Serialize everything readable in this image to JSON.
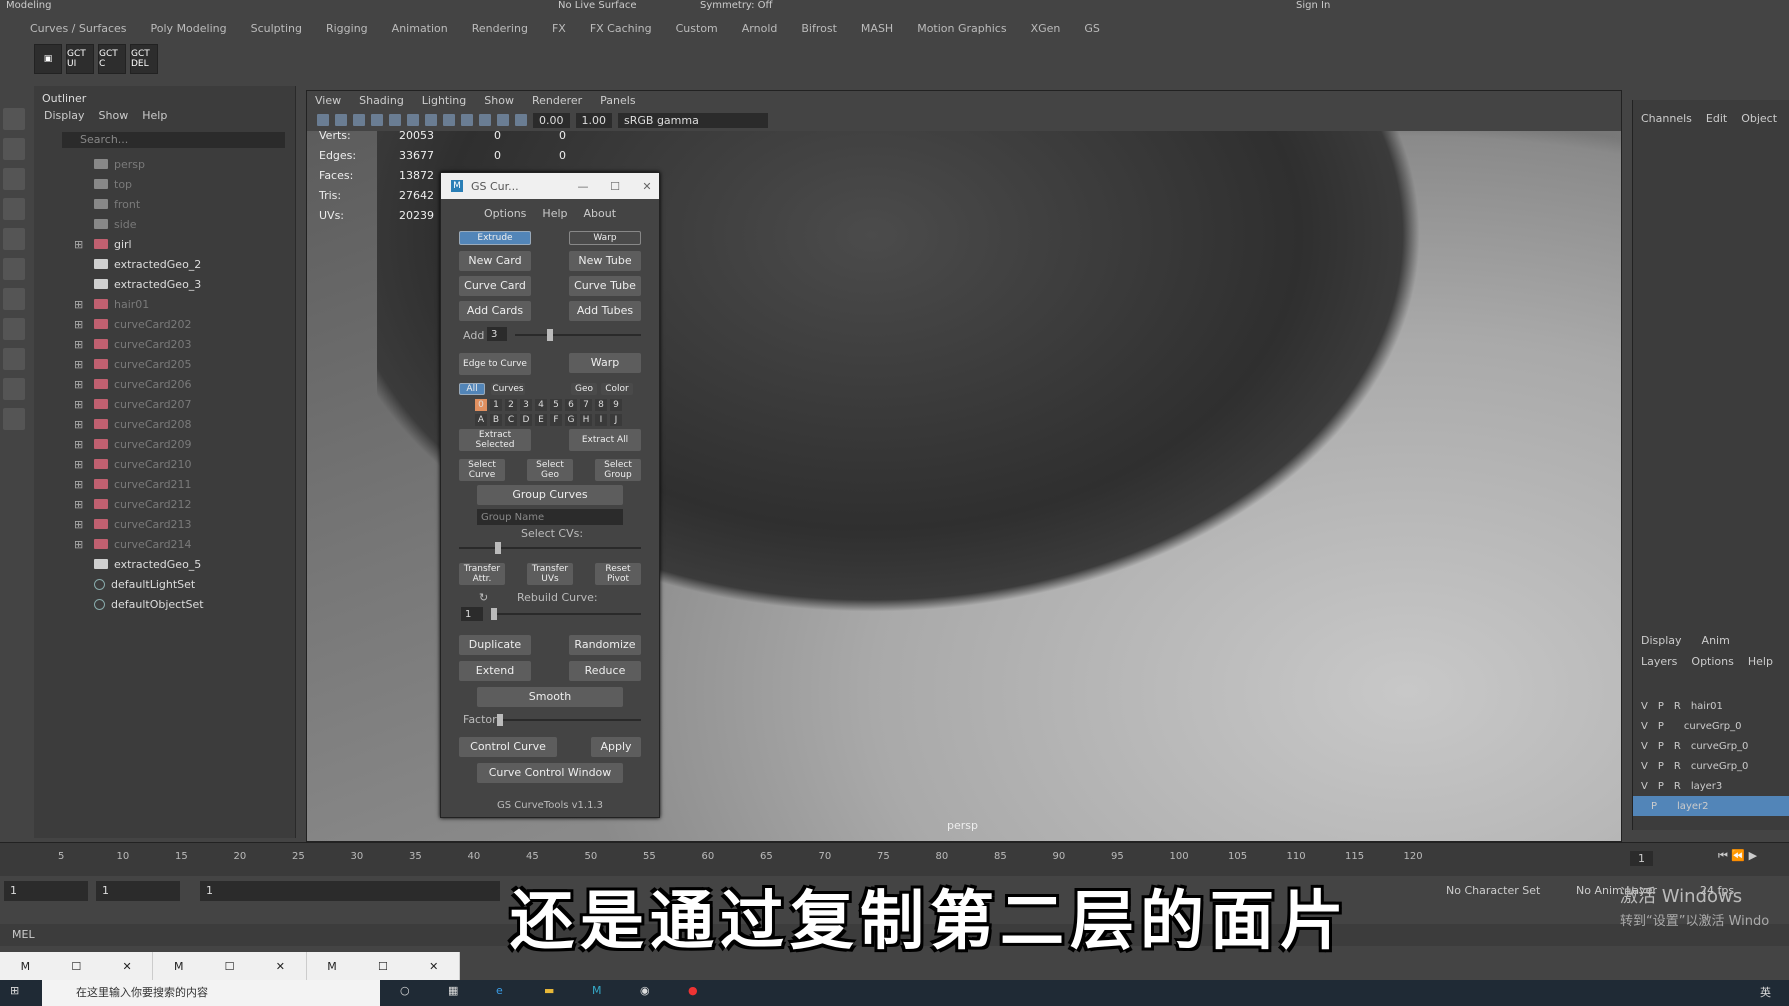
{
  "topbar": {
    "mode": "Modeling",
    "live_surface": "No Live Surface",
    "symmetry": "Symmetry: Off",
    "sign_in": "Sign In"
  },
  "shelf_tabs": [
    "Curves / Surfaces",
    "Poly Modeling",
    "Sculpting",
    "Rigging",
    "Animation",
    "Rendering",
    "FX",
    "FX Caching",
    "Custom",
    "Arnold",
    "Bifrost",
    "MASH",
    "Motion Graphics",
    "XGen",
    "GS"
  ],
  "shelf_icons": [
    "GCT UI",
    "GCT C",
    "GCT DEL"
  ],
  "outliner": {
    "title": "Outliner",
    "menu": [
      "Display",
      "Show",
      "Help"
    ],
    "search_placeholder": "Search...",
    "items": [
      {
        "label": "persp",
        "type": "cam",
        "dim": true,
        "expandable": false
      },
      {
        "label": "top",
        "type": "cam",
        "dim": true,
        "expandable": false
      },
      {
        "label": "front",
        "type": "cam",
        "dim": true,
        "expandable": false
      },
      {
        "label": "side",
        "type": "cam",
        "dim": true,
        "expandable": false
      },
      {
        "label": "girl",
        "type": "grp",
        "dim": false,
        "expandable": true
      },
      {
        "label": "extractedGeo_2",
        "type": "geo",
        "dim": false,
        "expandable": false
      },
      {
        "label": "extractedGeo_3",
        "type": "geo",
        "dim": false,
        "expandable": false
      },
      {
        "label": "hair01",
        "type": "grp",
        "dim": true,
        "expandable": true
      },
      {
        "label": "curveCard202",
        "type": "grp",
        "dim": true,
        "expandable": true
      },
      {
        "label": "curveCard203",
        "type": "grp",
        "dim": true,
        "expandable": true
      },
      {
        "label": "curveCard205",
        "type": "grp",
        "dim": true,
        "expandable": true
      },
      {
        "label": "curveCard206",
        "type": "grp",
        "dim": true,
        "expandable": true
      },
      {
        "label": "curveCard207",
        "type": "grp",
        "dim": true,
        "expandable": true
      },
      {
        "label": "curveCard208",
        "type": "grp",
        "dim": true,
        "expandable": true
      },
      {
        "label": "curveCard209",
        "type": "grp",
        "dim": true,
        "expandable": true
      },
      {
        "label": "curveCard210",
        "type": "grp",
        "dim": true,
        "expandable": true
      },
      {
        "label": "curveCard211",
        "type": "grp",
        "dim": true,
        "expandable": true
      },
      {
        "label": "curveCard212",
        "type": "grp",
        "dim": true,
        "expandable": true
      },
      {
        "label": "curveCard213",
        "type": "grp",
        "dim": true,
        "expandable": true
      },
      {
        "label": "curveCard214",
        "type": "grp",
        "dim": true,
        "expandable": true
      },
      {
        "label": "extractedGeo_5",
        "type": "geo",
        "dim": false,
        "expandable": false
      },
      {
        "label": "defaultLightSet",
        "type": "set",
        "dim": false,
        "expandable": false
      },
      {
        "label": "defaultObjectSet",
        "type": "set",
        "dim": false,
        "expandable": false
      }
    ]
  },
  "viewport": {
    "menu": [
      "View",
      "Shading",
      "Lighting",
      "Show",
      "Renderer",
      "Panels"
    ],
    "exposure": "0.00",
    "gamma": "1.00",
    "color_space": "sRGB gamma",
    "camera_label": "persp",
    "hud": [
      {
        "key": "Verts:",
        "v1": "20053",
        "v2": "0",
        "v3": "0"
      },
      {
        "key": "Edges:",
        "v1": "33677",
        "v2": "0",
        "v3": "0"
      },
      {
        "key": "Faces:",
        "v1": "13872",
        "v2": "",
        "v3": ""
      },
      {
        "key": "Tris:",
        "v1": "27642",
        "v2": "",
        "v3": ""
      },
      {
        "key": "UVs:",
        "v1": "20239",
        "v2": "",
        "v3": ""
      }
    ]
  },
  "gs_window": {
    "title": "GS Cur...",
    "menu": [
      "Options",
      "Help",
      "About"
    ],
    "mode_extrude": "Extrude",
    "mode_warp": "Warp",
    "new_card": "New Card",
    "new_tube": "New Tube",
    "curve_card": "Curve Card",
    "curve_tube": "Curve Tube",
    "add_cards": "Add Cards",
    "add_tubes": "Add Tubes",
    "add_label": "Add",
    "add_value": "3",
    "add_slider": 0.25,
    "edge_to_curve": "Edge to Curve",
    "warp_btn": "Warp",
    "filter_all": "All",
    "filter_curves": "Curves",
    "filter_geo": "Geo",
    "filter_color": "Color",
    "numbers": [
      "0",
      "1",
      "2",
      "3",
      "4",
      "5",
      "6",
      "7",
      "8",
      "9"
    ],
    "letters": [
      "A",
      "B",
      "C",
      "D",
      "E",
      "F",
      "G",
      "H",
      "I",
      "J"
    ],
    "extract_selected": "Extract Selected",
    "extract_all": "Extract All",
    "select_curve": "Select Curve",
    "select_geo": "Select Geo",
    "select_group": "Select Group",
    "group_curves": "Group Curves",
    "group_name_placeholder": "Group Name",
    "select_cvs": "Select CVs:",
    "select_cvs_slider": 0.2,
    "transfer_attr": "Transfer Attr.",
    "transfer_uvs": "Transfer UVs",
    "reset_pivot": "Reset Pivot",
    "rebuild_curve": "Rebuild Curve:",
    "rebuild_value": "1",
    "rebuild_slider": 0.0,
    "duplicate": "Duplicate",
    "randomize": "Randomize",
    "extend": "Extend",
    "reduce": "Reduce",
    "smooth": "Smooth",
    "factor": "Factor",
    "factor_slider": 0.0,
    "control_curve": "Control Curve",
    "apply": "Apply",
    "curve_control_window": "Curve Control Window",
    "version": "GS CurveTools v1.1.3"
  },
  "channels": {
    "menu": [
      "Channels",
      "Edit",
      "Object"
    ]
  },
  "layers": {
    "tabs": [
      "Display",
      "Anim"
    ],
    "menu": [
      "Layers",
      "Options",
      "Help"
    ],
    "rows": [
      {
        "v": "V",
        "p": "P",
        "r": "R",
        "name": "hair01",
        "active": false
      },
      {
        "v": "V",
        "p": "P",
        "r": "",
        "name": "curveGrp_0",
        "active": false
      },
      {
        "v": "V",
        "p": "P",
        "r": "R",
        "name": "curveGrp_0",
        "active": false
      },
      {
        "v": "V",
        "p": "P",
        "r": "R",
        "name": "curveGrp_0",
        "active": false
      },
      {
        "v": "V",
        "p": "P",
        "r": "R",
        "name": "layer3",
        "active": false
      },
      {
        "v": "",
        "p": "P",
        "r": "",
        "name": "layer2",
        "active": true
      }
    ]
  },
  "timeline": {
    "ticks": [
      "5",
      "10",
      "15",
      "20",
      "25",
      "30",
      "35",
      "40",
      "45",
      "50",
      "55",
      "60",
      "65",
      "70",
      "75",
      "80",
      "85",
      "90",
      "95",
      "100",
      "105",
      "110",
      "115",
      "120"
    ],
    "current_frame": "1",
    "end_field": "1"
  },
  "range": {
    "start": "1",
    "start2": "1",
    "frame": "1",
    "character_set": "No Character Set",
    "anim_layer": "No Anim Layer",
    "fps": "24 fps"
  },
  "cmdline": {
    "label": "MEL"
  },
  "subtitle": "还是通过复制第二层的面片",
  "watermark": {
    "line1": "激活 Windows",
    "line2": "转到“设置”以激活 Windo"
  },
  "taskbar": {
    "search_placeholder": "在这里输入你要搜索的内容",
    "lang": "英"
  }
}
